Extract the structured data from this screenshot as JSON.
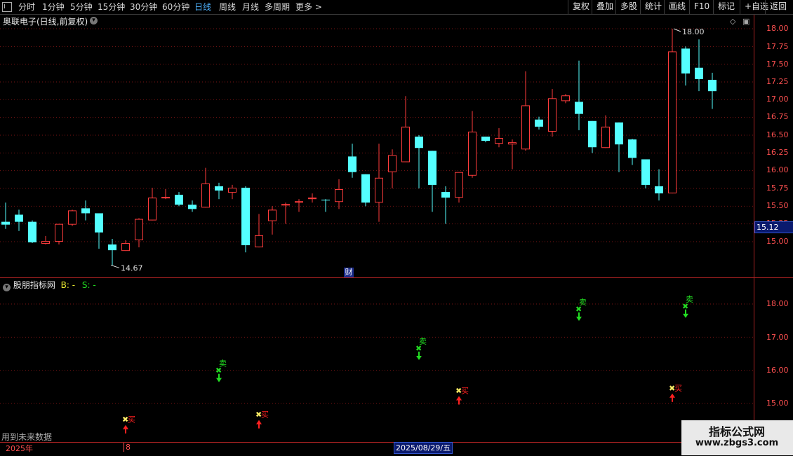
{
  "toolbar": {
    "periods": [
      "分时",
      "1分钟",
      "5分钟",
      "15分钟",
      "30分钟",
      "60分钟",
      "日线",
      "周线",
      "月线",
      "多周期",
      "更多 >"
    ],
    "active_period": "日线",
    "right_buttons": [
      "复权",
      "叠加",
      "多股",
      "统计",
      "画线",
      "F10",
      "标记",
      "+自选",
      "返回"
    ]
  },
  "chart_title": "奥联电子(日线,前复权)",
  "price_axis": [
    "18.00",
    "17.75",
    "17.50",
    "17.25",
    "17.00",
    "16.75",
    "16.50",
    "16.25",
    "16.00",
    "15.75",
    "15.50",
    "15.25",
    "15.00"
  ],
  "current_price": "15.12",
  "high_label": "18.00",
  "low_label": "14.67",
  "event_marker": "财",
  "indicator": {
    "name": "股朋指标网",
    "b_label": "B: -",
    "s_label": "S: -",
    "axis": [
      "18.00",
      "17.00",
      "16.00",
      "15.00"
    ],
    "buy_text": "买",
    "sell_text": "卖"
  },
  "future_note": "用到未来数据",
  "bottom": {
    "year": "2025年",
    "month": "8",
    "selected_date": "2025/08/29/五"
  },
  "watermark": {
    "line1": "指标公式网",
    "line2": "www.zbgs3.com"
  },
  "colors": {
    "up": "#ff3c3c",
    "down": "#54ffff",
    "buy": "#ff2020",
    "sell": "#22dd22",
    "axis": "#ff5050"
  },
  "chart_data": {
    "type": "candlestick",
    "ylim": [
      14.5,
      18.15
    ],
    "candles": [
      {
        "o": 15.28,
        "h": 15.55,
        "l": 15.18,
        "c": 15.24
      },
      {
        "o": 15.38,
        "h": 15.45,
        "l": 15.15,
        "c": 15.28
      },
      {
        "o": 15.28,
        "h": 15.3,
        "l": 14.98,
        "c": 14.99
      },
      {
        "o": 14.97,
        "h": 15.08,
        "l": 14.96,
        "c": 15.01
      },
      {
        "o": 15.0,
        "h": 15.25,
        "l": 14.96,
        "c": 15.25
      },
      {
        "o": 15.24,
        "h": 15.45,
        "l": 15.22,
        "c": 15.44
      },
      {
        "o": 15.47,
        "h": 15.58,
        "l": 15.3,
        "c": 15.4
      },
      {
        "o": 15.4,
        "h": 15.4,
        "l": 14.9,
        "c": 15.13
      },
      {
        "o": 14.96,
        "h": 15.04,
        "l": 14.67,
        "c": 14.88
      },
      {
        "o": 14.87,
        "h": 15.02,
        "l": 14.87,
        "c": 14.98
      },
      {
        "o": 15.02,
        "h": 15.33,
        "l": 14.92,
        "c": 15.32
      },
      {
        "o": 15.3,
        "h": 15.76,
        "l": 15.3,
        "c": 15.62
      },
      {
        "o": 15.63,
        "h": 15.74,
        "l": 15.6,
        "c": 15.63
      },
      {
        "o": 15.66,
        "h": 15.7,
        "l": 15.5,
        "c": 15.52
      },
      {
        "o": 15.52,
        "h": 15.58,
        "l": 15.42,
        "c": 15.46
      },
      {
        "o": 15.48,
        "h": 16.04,
        "l": 15.48,
        "c": 15.82
      },
      {
        "o": 15.78,
        "h": 15.83,
        "l": 15.6,
        "c": 15.72
      },
      {
        "o": 15.69,
        "h": 15.8,
        "l": 15.6,
        "c": 15.76
      },
      {
        "o": 15.76,
        "h": 15.78,
        "l": 14.85,
        "c": 14.95
      },
      {
        "o": 14.92,
        "h": 15.39,
        "l": 14.92,
        "c": 15.09
      },
      {
        "o": 15.29,
        "h": 15.5,
        "l": 15.1,
        "c": 15.45
      },
      {
        "o": 15.52,
        "h": 15.55,
        "l": 15.25,
        "c": 15.53
      },
      {
        "o": 15.55,
        "h": 15.6,
        "l": 15.42,
        "c": 15.57
      },
      {
        "o": 15.6,
        "h": 15.68,
        "l": 15.55,
        "c": 15.62
      },
      {
        "o": 15.59,
        "h": 15.6,
        "l": 15.42,
        "c": 15.58
      },
      {
        "o": 15.56,
        "h": 15.88,
        "l": 15.46,
        "c": 15.74
      },
      {
        "o": 16.2,
        "h": 16.38,
        "l": 15.9,
        "c": 15.98
      },
      {
        "o": 15.95,
        "h": 15.95,
        "l": 15.5,
        "c": 15.55
      },
      {
        "o": 15.55,
        "h": 16.38,
        "l": 15.28,
        "c": 15.9
      },
      {
        "o": 15.98,
        "h": 16.3,
        "l": 15.75,
        "c": 16.22
      },
      {
        "o": 16.12,
        "h": 17.05,
        "l": 16.12,
        "c": 16.62
      },
      {
        "o": 16.48,
        "h": 16.5,
        "l": 15.75,
        "c": 16.32
      },
      {
        "o": 16.28,
        "h": 16.28,
        "l": 15.42,
        "c": 15.8
      },
      {
        "o": 15.7,
        "h": 15.78,
        "l": 15.25,
        "c": 15.62
      },
      {
        "o": 15.62,
        "h": 15.98,
        "l": 15.55,
        "c": 15.98
      },
      {
        "o": 15.93,
        "h": 16.84,
        "l": 15.9,
        "c": 16.55
      },
      {
        "o": 16.48,
        "h": 16.48,
        "l": 16.4,
        "c": 16.42
      },
      {
        "o": 16.38,
        "h": 16.6,
        "l": 16.33,
        "c": 16.46
      },
      {
        "o": 16.37,
        "h": 16.44,
        "l": 16.02,
        "c": 16.4
      },
      {
        "o": 16.3,
        "h": 17.4,
        "l": 16.28,
        "c": 16.92
      },
      {
        "o": 16.72,
        "h": 16.76,
        "l": 16.58,
        "c": 16.62
      },
      {
        "o": 16.55,
        "h": 17.15,
        "l": 16.48,
        "c": 17.02
      },
      {
        "o": 16.98,
        "h": 17.08,
        "l": 16.95,
        "c": 17.06
      },
      {
        "o": 16.97,
        "h": 17.55,
        "l": 16.57,
        "c": 16.8
      },
      {
        "o": 16.7,
        "h": 16.7,
        "l": 16.25,
        "c": 16.33
      },
      {
        "o": 16.32,
        "h": 16.78,
        "l": 16.32,
        "c": 16.62
      },
      {
        "o": 16.68,
        "h": 16.68,
        "l": 15.98,
        "c": 16.37
      },
      {
        "o": 16.44,
        "h": 16.45,
        "l": 16.08,
        "c": 16.18
      },
      {
        "o": 16.16,
        "h": 16.16,
        "l": 15.75,
        "c": 15.8
      },
      {
        "o": 15.78,
        "h": 16.02,
        "l": 15.58,
        "c": 15.68
      },
      {
        "o": 15.68,
        "h": 18.0,
        "l": 15.68,
        "c": 17.68
      },
      {
        "o": 17.72,
        "h": 17.75,
        "l": 17.2,
        "c": 17.37
      },
      {
        "o": 17.45,
        "h": 17.85,
        "l": 17.12,
        "c": 17.29
      },
      {
        "o": 17.28,
        "h": 17.38,
        "l": 16.87,
        "c": 17.12
      }
    ],
    "signals": [
      {
        "i": 9,
        "type": "buy",
        "v": 14.52
      },
      {
        "i": 16,
        "type": "sell",
        "v": 16.0
      },
      {
        "i": 19,
        "type": "buy",
        "v": 14.67
      },
      {
        "i": 31,
        "type": "sell",
        "v": 16.67
      },
      {
        "i": 34,
        "type": "buy",
        "v": 15.39
      },
      {
        "i": 43,
        "type": "sell",
        "v": 17.85
      },
      {
        "i": 50,
        "type": "buy",
        "v": 15.47
      },
      {
        "i": 51,
        "type": "sell",
        "v": 17.94
      }
    ]
  }
}
